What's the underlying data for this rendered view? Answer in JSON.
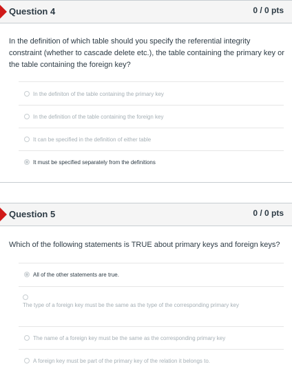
{
  "questions": [
    {
      "title": "Question 4",
      "points": "0 / 0 pts",
      "text": "In the definition of which table should you specify the referential integrity constraint (whether to cascade delete etc.), the table containing the primary key or the table containing the foreign key?",
      "answers": [
        {
          "label": "In the definiton of the table containing the primary key",
          "selected": false
        },
        {
          "label": "In the definition of the table containing the foreign key",
          "selected": false
        },
        {
          "label": "It can be specified in the definition of either table",
          "selected": false
        },
        {
          "label": "It must be specified separately from the definitions",
          "selected": true
        }
      ]
    },
    {
      "title": "Question 5",
      "points": "0 / 0 pts",
      "text": "Which of the following statements is TRUE about primary keys and foreign keys?",
      "answers": [
        {
          "label": "All of the other statements are true.",
          "selected": true
        },
        {
          "label": "The type of a foreign key must be the same as the type of the corresponding primary key",
          "selected": false
        },
        {
          "label": "The name of a foreign key must be the same as the corresponding primary key",
          "selected": false
        },
        {
          "label": "A foreign key must be part of the primary key of the relation it belongs to.",
          "selected": false
        }
      ]
    }
  ],
  "colors": {
    "flag": "#d01a19",
    "header_bg": "#f5f5f5",
    "text": "#2d3b45",
    "muted": "#a5afb5"
  }
}
